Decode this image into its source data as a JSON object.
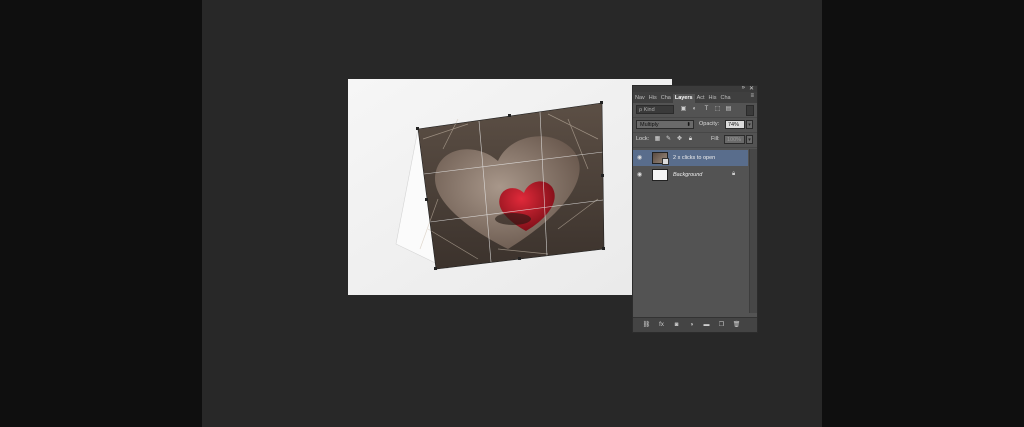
{
  "panel": {
    "collapse_icon": "double-chevron-icon",
    "close_icon": "close-icon",
    "tabs": [
      {
        "label": "Nav",
        "active": false
      },
      {
        "label": "His",
        "active": false
      },
      {
        "label": "Cha",
        "active": false
      },
      {
        "label": "Layers",
        "active": true
      },
      {
        "label": "Act",
        "active": false
      },
      {
        "label": "His",
        "active": false
      },
      {
        "label": "Cha",
        "active": false
      }
    ],
    "menu_glyph": "≡",
    "filter": {
      "label": "Kind",
      "glyph": "ρ"
    },
    "blend_mode": "Multiply",
    "opacity_label": "Opacity:",
    "opacity_value": "74%",
    "lock_label": "Lock:",
    "fill_label": "Fill:",
    "fill_value": "100%",
    "layers": [
      {
        "name": "2 x clicks to open",
        "selected": true,
        "type": "smart-object"
      },
      {
        "name": "Background",
        "selected": false,
        "type": "background",
        "locked": true
      }
    ],
    "bottom_icons": [
      "link-icon",
      "fx-icon",
      "mask-icon",
      "adjustment-icon",
      "folder-icon",
      "new-layer-icon",
      "trash-icon"
    ]
  },
  "bottom_glyphs": {
    "fx": "fx"
  }
}
